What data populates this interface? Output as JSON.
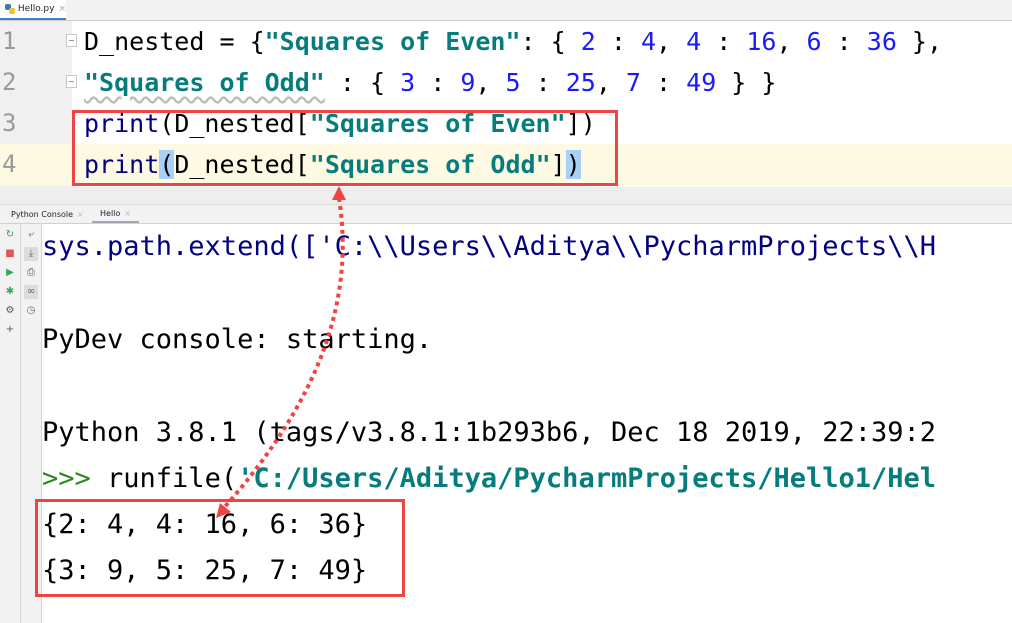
{
  "editor": {
    "tab": {
      "label": "Hello.py",
      "icon": "python-file-icon"
    },
    "lines": [
      {
        "number": "1",
        "segments": [
          {
            "t": "D_nested = {",
            "c": ""
          },
          {
            "t": "\"Squares of Even\"",
            "c": "k-str"
          },
          {
            "t": ": { ",
            "c": ""
          },
          {
            "t": "2",
            "c": "k-num"
          },
          {
            "t": " : ",
            "c": ""
          },
          {
            "t": "4",
            "c": "k-num"
          },
          {
            "t": ", ",
            "c": ""
          },
          {
            "t": "4",
            "c": "k-num"
          },
          {
            "t": " : ",
            "c": ""
          },
          {
            "t": "16",
            "c": "k-num"
          },
          {
            "t": ", ",
            "c": ""
          },
          {
            "t": "6",
            "c": "k-num"
          },
          {
            "t": " : ",
            "c": ""
          },
          {
            "t": "36",
            "c": "k-num"
          },
          {
            "t": " },",
            "c": ""
          }
        ]
      },
      {
        "number": "2",
        "segments": [
          {
            "t": "\"Squares of Odd\"",
            "c": "k-str squiggle"
          },
          {
            "t": " : { ",
            "c": ""
          },
          {
            "t": "3",
            "c": "k-num"
          },
          {
            "t": " : ",
            "c": ""
          },
          {
            "t": "9",
            "c": "k-num"
          },
          {
            "t": ", ",
            "c": ""
          },
          {
            "t": "5",
            "c": "k-num"
          },
          {
            "t": " : ",
            "c": ""
          },
          {
            "t": "25",
            "c": "k-num"
          },
          {
            "t": ", ",
            "c": ""
          },
          {
            "t": "7",
            "c": "k-num"
          },
          {
            "t": " : ",
            "c": ""
          },
          {
            "t": "49",
            "c": "k-num"
          },
          {
            "t": " } }",
            "c": ""
          }
        ]
      },
      {
        "number": "3",
        "segments": [
          {
            "t": "print",
            "c": "k-fn"
          },
          {
            "t": "(D_nested[",
            "c": ""
          },
          {
            "t": "\"Squares of Even\"",
            "c": "k-str"
          },
          {
            "t": "])",
            "c": ""
          }
        ]
      },
      {
        "number": "4",
        "segments": [
          {
            "t": "print",
            "c": "k-fn"
          },
          {
            "t": "(",
            "c": "k-brace-hl"
          },
          {
            "t": "D_nested[",
            "c": ""
          },
          {
            "t": "\"Squares of Odd\"",
            "c": "k-str"
          },
          {
            "t": "]",
            "c": ""
          },
          {
            "t": ")",
            "c": "k-brace-hl"
          }
        ]
      }
    ],
    "current_line": 4
  },
  "tool_tabs": [
    {
      "label": "Python Console",
      "active": false
    },
    {
      "label": "Hello",
      "active": true
    }
  ],
  "console_toolbar_left": [
    {
      "icon": "rerun-icon",
      "glyph": "↻",
      "color": "#3aa55d"
    },
    {
      "icon": "stop-icon",
      "glyph": "■",
      "color": "#e05555"
    },
    {
      "icon": "run-icon",
      "glyph": "▶",
      "color": "#3aa55d"
    },
    {
      "icon": "debug-bug-icon",
      "glyph": "✱",
      "color": "#3aa55d"
    },
    {
      "icon": "settings-gear-icon",
      "glyph": "⚙",
      "color": "#555555"
    },
    {
      "icon": "add-icon",
      "glyph": "+",
      "color": "#555555"
    }
  ],
  "console_toolbar_right": [
    {
      "icon": "soft-wrap-icon",
      "glyph": "⤶",
      "color": "#666666",
      "pressed": false
    },
    {
      "icon": "scroll-to-end-icon",
      "glyph": "⤓",
      "color": "#666666",
      "pressed": true
    },
    {
      "icon": "print-icon",
      "glyph": "⎙",
      "color": "#555555",
      "pressed": false
    },
    {
      "icon": "show-variables-icon",
      "glyph": "∞",
      "color": "#666666",
      "pressed": true
    },
    {
      "icon": "history-clock-icon",
      "glyph": "◷",
      "color": "#666666",
      "pressed": false
    }
  ],
  "console": {
    "lines": [
      {
        "segments": [
          {
            "t": "sys.path.extend(['C:\\\\Users\\\\Aditya\\\\PycharmProjects\\\\H",
            "c": "c-blue"
          }
        ]
      },
      {
        "segments": []
      },
      {
        "segments": [
          {
            "t": "PyDev console: starting.",
            "c": ""
          }
        ]
      },
      {
        "segments": []
      },
      {
        "segments": [
          {
            "t": "Python 3.8.1 (tags/v3.8.1:1b293b6, Dec 18 2019, 22:39:2",
            "c": ""
          }
        ]
      },
      {
        "segments": [
          {
            "t": ">>> ",
            "c": "c-prompt"
          },
          {
            "t": "runfile(",
            "c": ""
          },
          {
            "t": "'C:/Users/Aditya/PycharmProjects/Hello1/Hel",
            "c": "c-teal"
          }
        ]
      },
      {
        "segments": [
          {
            "t": "{2: 4, 4: 16, 6: 36}",
            "c": ""
          }
        ]
      },
      {
        "segments": [
          {
            "t": "{3: 9, 5: 25, 7: 49}",
            "c": ""
          }
        ]
      }
    ]
  },
  "annotation": {
    "color": "#ef4444"
  }
}
